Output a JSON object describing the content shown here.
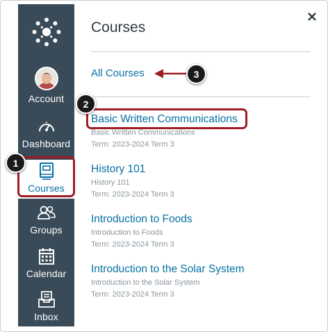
{
  "nav": {
    "account_label": "Account",
    "dashboard_label": "Dashboard",
    "courses_label": "Courses",
    "groups_label": "Groups",
    "calendar_label": "Calendar",
    "inbox_label": "Inbox"
  },
  "tray": {
    "title": "Courses",
    "close_symbol": "×",
    "all_courses": "All Courses",
    "courses": [
      {
        "name": "Basic Written Communications",
        "subtitle": "Basic Written Communications",
        "term": "Term: 2023-2024 Term 3"
      },
      {
        "name": "History 101",
        "subtitle": "History 101",
        "term": "Term: 2023-2024 Term 3"
      },
      {
        "name": "Introduction to Foods",
        "subtitle": "Introduction to Foods",
        "term": "Term: 2023-2024 Term 3"
      },
      {
        "name": "Introduction to the Solar System",
        "subtitle": "Introduction to the Solar System",
        "term": "Term: 2023-2024 Term 3"
      }
    ]
  },
  "callouts": {
    "one": "1",
    "two": "2",
    "three": "3"
  },
  "colors": {
    "nav_bg": "#394b58",
    "link": "#0770a3",
    "highlight": "#9e1c23",
    "muted_text": "#8b969e"
  },
  "icons": [
    "canvas-logo-icon",
    "avatar",
    "dashboard-gauge-icon",
    "courses-book-icon",
    "groups-people-icon",
    "calendar-icon",
    "inbox-tray-icon",
    "close-icon",
    "arrow-left-icon"
  ]
}
